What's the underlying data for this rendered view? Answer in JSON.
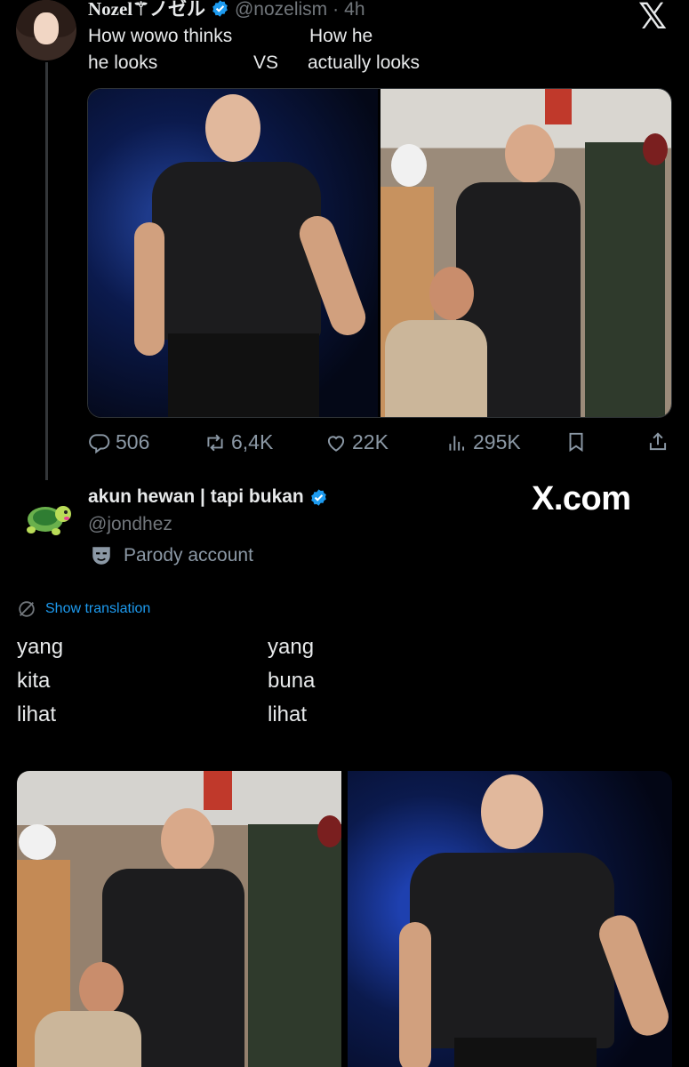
{
  "app": {
    "logo_glyph": "𝕏"
  },
  "tweet1": {
    "display_name": "Nozel⚚ノゼル",
    "handle": "@nozelism",
    "separator": "·",
    "time": "4h",
    "text_left_line1": "How wowo thinks",
    "text_left_line2": "he looks",
    "text_vs": "VS",
    "text_right_line1": "How he",
    "text_right_line2": "actually looks",
    "stats": {
      "replies": "506",
      "reposts": "6,4K",
      "likes": "22K",
      "views": "295K"
    }
  },
  "tweet2": {
    "display_name": "akun hewan | tapi bukan",
    "handle": "@jondhez",
    "parody_label": "Parody account",
    "watermark": "X.com",
    "show_translation": "Show translation",
    "col_left": [
      "yang",
      "kita",
      "lihat"
    ],
    "col_right": [
      "yang",
      "buna",
      "lihat"
    ]
  },
  "colors": {
    "background": "#000000",
    "text": "#e7e9ea",
    "muted": "#71767b",
    "accent": "#1d9bf0",
    "verified": "#1d9bf0"
  },
  "icons": [
    "verified-badge-icon",
    "x-logo-icon",
    "reply-icon",
    "repost-icon",
    "like-icon",
    "views-icon",
    "bookmark-icon",
    "share-icon",
    "turtle-avatar-icon",
    "parody-mask-icon",
    "translate-icon"
  ]
}
